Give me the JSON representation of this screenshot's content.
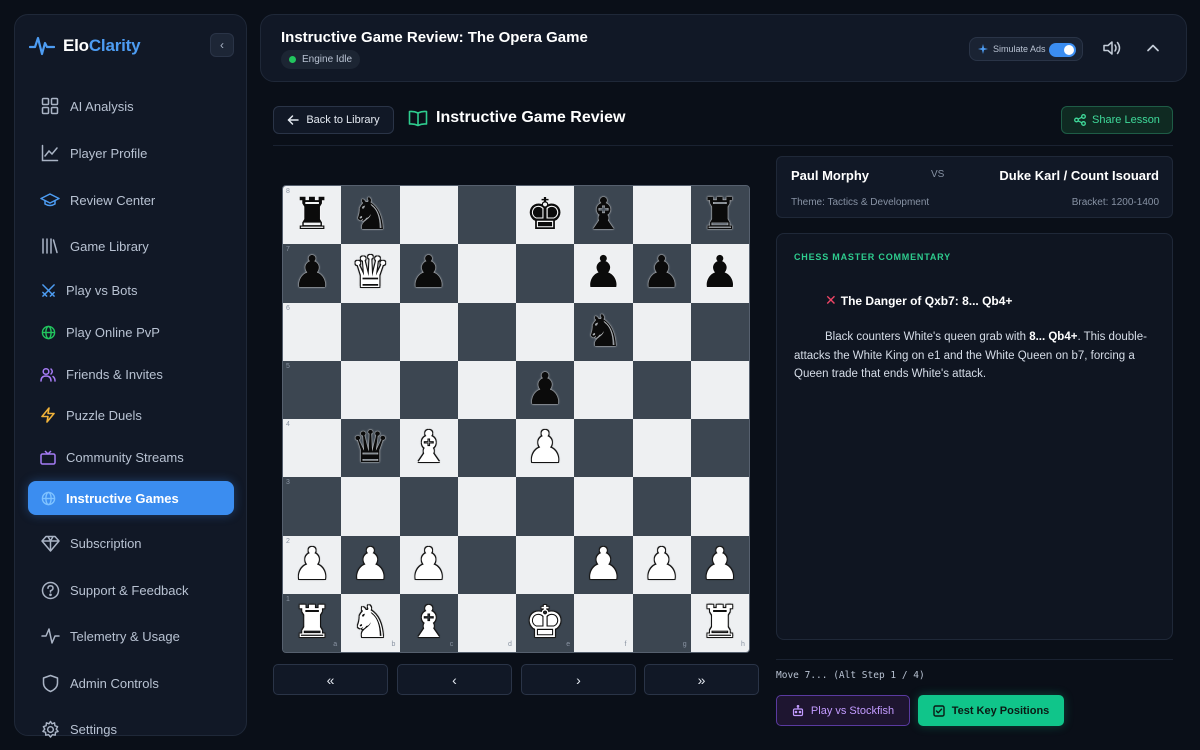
{
  "brand": {
    "name_left": "Elo",
    "name_right": "Clarity",
    "accent": "#4d9cf2"
  },
  "sidebar": {
    "collapse_glyph": "‹",
    "items": [
      {
        "label": "AI Analysis",
        "icon": "grid-icon"
      },
      {
        "label": "Player Profile",
        "icon": "chart-line-icon"
      },
      {
        "label": "Review Center",
        "icon": "graduation-cap-icon"
      },
      {
        "label": "Game Library",
        "icon": "library-icon"
      },
      {
        "label": "Play vs Bots",
        "icon": "swords-icon"
      },
      {
        "label": "Play Online PvP",
        "icon": "globe-icon"
      },
      {
        "label": "Friends & Invites",
        "icon": "users-icon"
      },
      {
        "label": "Puzzle Duels",
        "icon": "bolt-icon"
      },
      {
        "label": "Community Streams",
        "icon": "tv-icon"
      },
      {
        "label": "Instructive Games",
        "icon": "globe-icon",
        "active": true
      },
      {
        "label": "Subscription",
        "icon": "diamond-icon"
      },
      {
        "label": "Support & Feedback",
        "icon": "help-circle-icon"
      },
      {
        "label": "Telemetry & Usage",
        "icon": "activity-icon"
      },
      {
        "label": "Admin Controls",
        "icon": "shield-icon"
      },
      {
        "label": "Settings",
        "icon": "gear-icon"
      }
    ]
  },
  "header": {
    "title": "Instructive Game Review: The Opera Game",
    "engine_status": "Engine Idle",
    "simulate_ads_label": "Simulate Ads",
    "simulate_ads_on": true
  },
  "toolbar": {
    "back_label": "Back to Library",
    "review_title": "Instructive Game Review",
    "share_label": "Share Lesson"
  },
  "board": {
    "ranks": [
      "8",
      "7",
      "6",
      "5",
      "4",
      "3",
      "2",
      "1"
    ],
    "files": [
      "a",
      "b",
      "c",
      "d",
      "e",
      "f",
      "g",
      "h"
    ],
    "rows": [
      [
        "bR",
        "bN",
        "",
        "",
        "bK",
        "bB",
        "",
        "bR"
      ],
      [
        "bP",
        "wQ",
        "bP",
        "",
        "",
        "bP",
        "bP",
        "bP"
      ],
      [
        "",
        "",
        "",
        "",
        "",
        "bN",
        "",
        ""
      ],
      [
        "",
        "",
        "",
        "",
        "bP",
        "",
        "",
        ""
      ],
      [
        "",
        "bQ",
        "wB",
        "",
        "wP",
        "",
        "",
        ""
      ],
      [
        "",
        "",
        "",
        "",
        "",
        "",
        "",
        ""
      ],
      [
        "wP",
        "wP",
        "wP",
        "",
        "",
        "wP",
        "wP",
        "wP"
      ],
      [
        "wR",
        "wN",
        "wB",
        "",
        "wK",
        "",
        "",
        "wR"
      ]
    ]
  },
  "controls": {
    "first": "«",
    "prev": "‹",
    "next": "›",
    "last": "»"
  },
  "match": {
    "white": "Paul Morphy",
    "vs": "VS",
    "black": "Duke Karl / Count Isouard",
    "theme": "Theme: Tactics & Development",
    "bracket": "Bracket: 1200-1400"
  },
  "commentary": {
    "label": "CHESS MASTER COMMENTARY",
    "heading": "The Danger of Qxb7: 8... Qb4+",
    "body_pre": "Black counters White's queen grab with ",
    "body_move": "8... Qb4+",
    "body_post": ". This double-attacks the White King on e1 and the White Queen on b7, forcing a Queen trade that ends White's attack."
  },
  "move_info": "Move 7... (Alt Step 1 / 4)",
  "actions": {
    "play_stockfish": "Play vs Stockfish",
    "test_positions": "Test Key Positions"
  }
}
